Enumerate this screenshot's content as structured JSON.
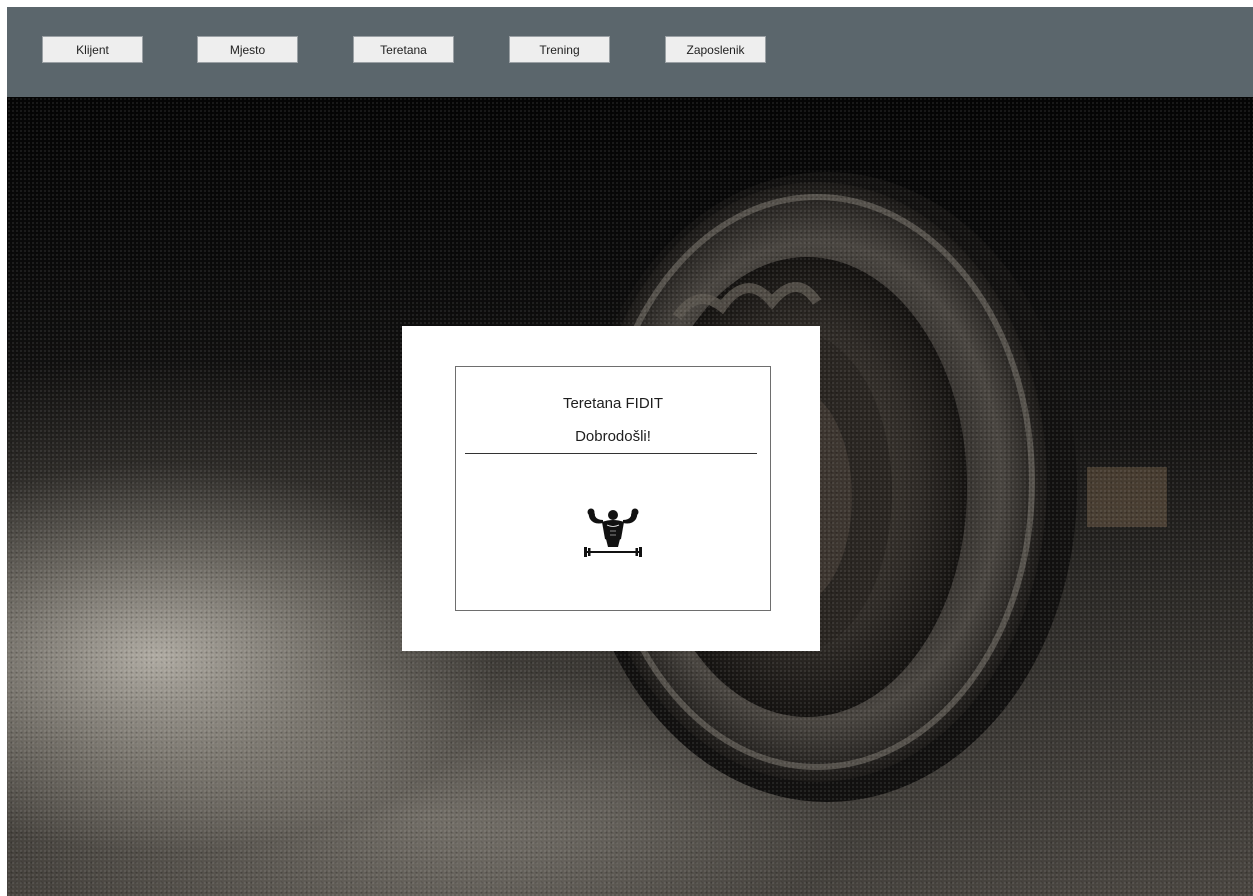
{
  "nav": {
    "items": [
      {
        "label": "Klijent"
      },
      {
        "label": "Mjesto"
      },
      {
        "label": "Teretana"
      },
      {
        "label": "Trening"
      },
      {
        "label": "Zaposlenik"
      }
    ]
  },
  "welcome": {
    "title": "Teretana FIDIT",
    "subtitle": "Dobrodošli!",
    "logo_icon": "bodybuilder-barbell-icon"
  },
  "colors": {
    "navbar": "#5b666c",
    "button": "#eeeeee",
    "dialog": "#ffffff"
  }
}
